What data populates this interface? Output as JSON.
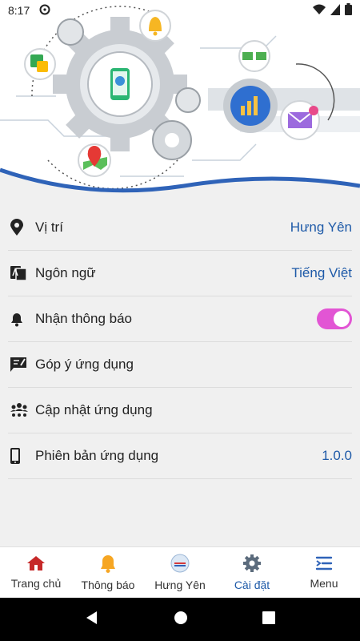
{
  "status_bar": {
    "time": "8:17"
  },
  "settings": [
    {
      "icon": "location-pin-icon",
      "label": "Vị trí",
      "value": "Hưng Yên"
    },
    {
      "icon": "translate-icon",
      "label": "Ngôn ngữ",
      "value": "Tiếng Việt"
    },
    {
      "icon": "bell-icon",
      "label": "Nhận thông báo",
      "toggle_on": true
    },
    {
      "icon": "feedback-icon",
      "label": "Góp ý ứng dụng"
    },
    {
      "icon": "users-update-icon",
      "label": "Cập nhật ứng dụng"
    },
    {
      "icon": "phone-icon",
      "label": "Phiên bản ứng dụng",
      "value": "1.0.0"
    }
  ],
  "nav": [
    {
      "icon": "home-icon",
      "label": "Trang chủ",
      "active": false
    },
    {
      "icon": "bell-icon",
      "label": "Thông báo",
      "active": false
    },
    {
      "icon": "province-logo-icon",
      "label": "Hưng Yên",
      "active": false
    },
    {
      "icon": "gear-icon",
      "label": "Cài đặt",
      "active": true
    },
    {
      "icon": "menu-icon",
      "label": "Menu",
      "active": false
    }
  ],
  "colors": {
    "accent": "#1e5aa8",
    "toggle": "#e255d4",
    "home_red": "#c62828"
  }
}
